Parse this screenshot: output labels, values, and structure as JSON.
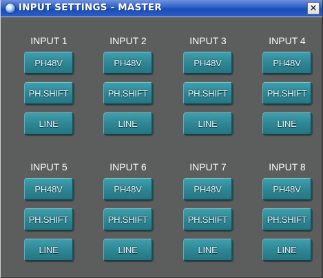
{
  "window": {
    "title": "INPUT SETTINGS - MASTER",
    "close_label": "✕",
    "colors": {
      "titlebar": "#2b60c8",
      "background": "#5c5d5d",
      "button": "#2f8795",
      "text": "#ffffff"
    }
  },
  "inputs": [
    {
      "label": "INPUT 1",
      "ph48v": "PH48V",
      "phshift": "PH.SHIFT",
      "line": "LINE"
    },
    {
      "label": "INPUT 2",
      "ph48v": "PH48V",
      "phshift": "PH.SHIFT",
      "line": "LINE"
    },
    {
      "label": "INPUT 3",
      "ph48v": "PH48V",
      "phshift": "PH.SHIFT",
      "line": "LINE"
    },
    {
      "label": "INPUT 4",
      "ph48v": "PH48V",
      "phshift": "PH.SHIFT",
      "line": "LINE"
    },
    {
      "label": "INPUT 5",
      "ph48v": "PH48V",
      "phshift": "PH.SHIFT",
      "line": "LINE"
    },
    {
      "label": "INPUT 6",
      "ph48v": "PH48V",
      "phshift": "PH.SHIFT",
      "line": "LINE"
    },
    {
      "label": "INPUT 7",
      "ph48v": "PH48V",
      "phshift": "PH.SHIFT",
      "line": "LINE"
    },
    {
      "label": "INPUT 8",
      "ph48v": "PH48V",
      "phshift": "PH.SHIFT",
      "line": "LINE"
    }
  ]
}
